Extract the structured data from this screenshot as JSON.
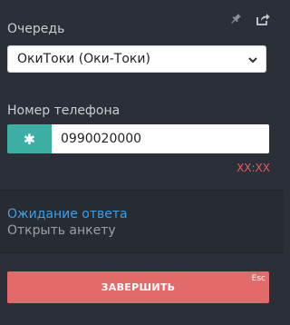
{
  "header": {
    "pin_icon": "pin-icon",
    "share_icon": "share-icon"
  },
  "queue": {
    "label": "Очередь",
    "selected": "ОкиТоки (Оки-Токи)"
  },
  "phone": {
    "label": "Номер телефона",
    "button_symbol": "✱",
    "value": "0990020000",
    "timer": "XX:XX"
  },
  "call_status": {
    "status_text": "Ожидание ответа",
    "open_form_text": "Открыть анкету"
  },
  "actions": {
    "finish_label": "ЗАВЕРШИТЬ",
    "finish_shortcut": "Esc"
  },
  "colors": {
    "background": "#2b3038",
    "accent_teal": "#3daea4",
    "link_blue": "#3a9ff0",
    "danger_red": "#e36a6a",
    "timer_red": "#e85c5c"
  }
}
